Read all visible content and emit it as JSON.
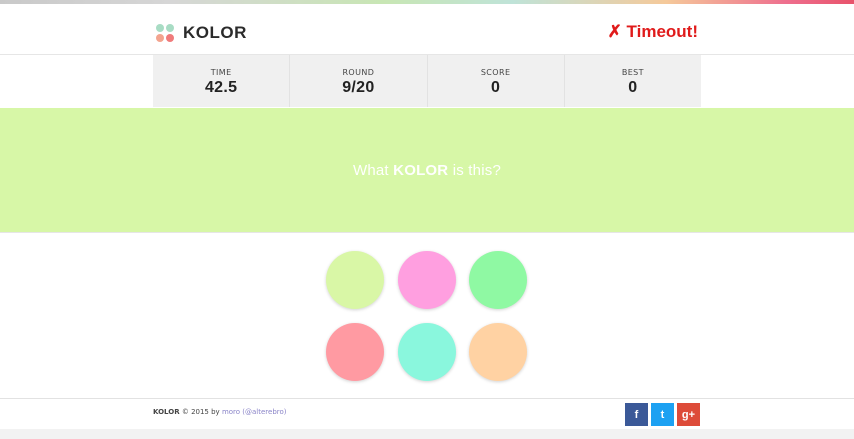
{
  "header": {
    "logo_text": "KOLOR",
    "status": "✗ Timeout!"
  },
  "stats": [
    {
      "label": "TIME",
      "value": "42.5"
    },
    {
      "label": "ROUND",
      "value": "9/20"
    },
    {
      "label": "SCORE",
      "value": "0"
    },
    {
      "label": "BEST",
      "value": "0"
    }
  ],
  "question": {
    "prefix": "What ",
    "brand": "KOLOR",
    "suffix": " is this?",
    "color": "#d7f7a7"
  },
  "swatches": [
    {
      "color": "#d9f7a6"
    },
    {
      "color": "#ff9fe0"
    },
    {
      "color": "#8ff9a3"
    },
    {
      "color": "#ff9aa2"
    },
    {
      "color": "#8af7dd"
    },
    {
      "color": "#ffd2a3"
    }
  ],
  "footer": {
    "brand": "KOLOR",
    "copyright": " © 2015 by ",
    "author": "moro",
    "handle": "(@alterebro)"
  },
  "social": [
    {
      "name": "facebook",
      "glyph": "f",
      "color": "#3b5998"
    },
    {
      "name": "twitter",
      "glyph": "t",
      "color": "#1da1f2"
    },
    {
      "name": "google-plus",
      "glyph": "g+",
      "color": "#dd4b39"
    }
  ],
  "colors": {
    "accent_red": "#e01b1b",
    "stats_bg": "#f0f0f0"
  }
}
